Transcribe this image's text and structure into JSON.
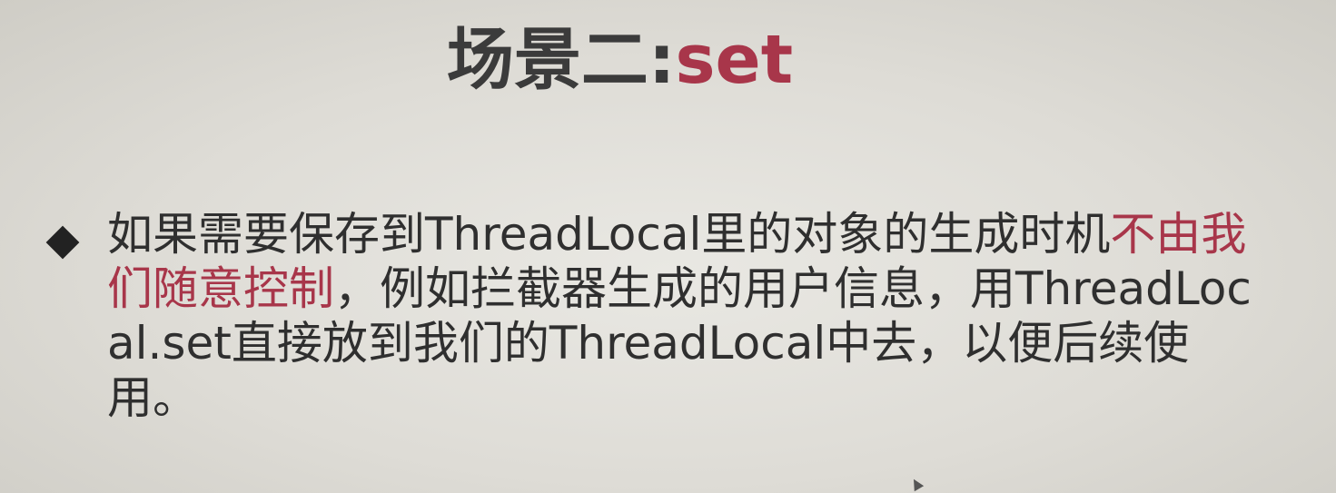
{
  "title": {
    "prefix": "场景二:",
    "accent": "set"
  },
  "bullet": {
    "text_part1": "如果需要保存到ThreadLocal里的对象的生成时机",
    "accent": "不由我们随意控制",
    "text_part2": "，例如拦截器生成的用户信息，用ThreadLocal.set直接放到我们的ThreadLocal中去，以便后续使用。"
  },
  "colors": {
    "text": "#2f2f2f",
    "title": "#3b3b3b",
    "accent": "#a8364a",
    "background": "#e2e0da"
  }
}
